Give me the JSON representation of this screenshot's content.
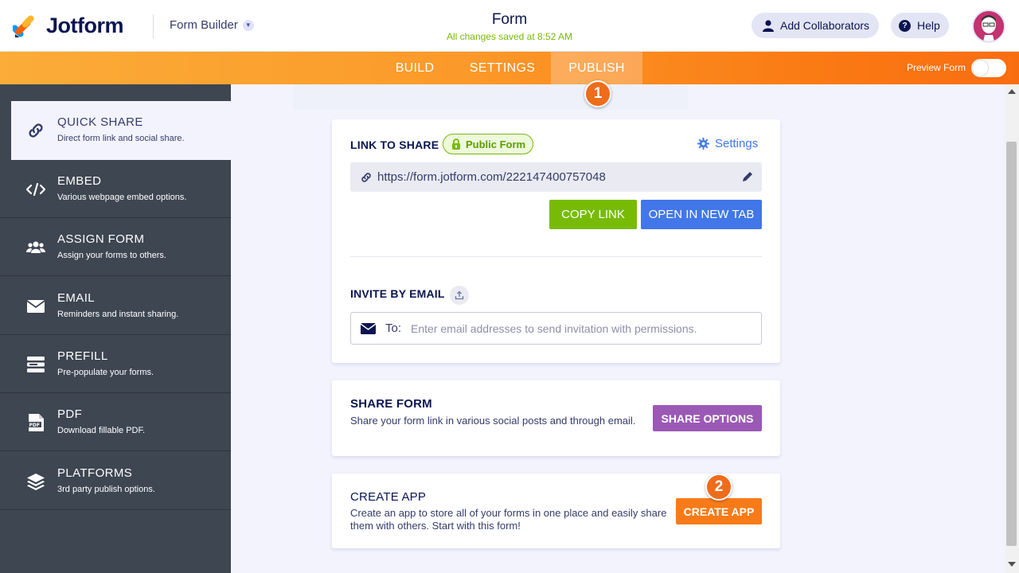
{
  "header": {
    "logo_text": "Jotform",
    "builder_label": "Form Builder",
    "form_title": "Form",
    "saved_status": "All changes saved at 8:52 AM",
    "collaborators_label": "Add Collaborators",
    "help_label": "Help"
  },
  "navbar": {
    "tabs": [
      {
        "label": "BUILD"
      },
      {
        "label": "SETTINGS"
      },
      {
        "label": "PUBLISH"
      }
    ],
    "active_tab": "PUBLISH",
    "preview_label": "Preview Form",
    "preview_enabled": false
  },
  "steps": {
    "step1": "1",
    "step2": "2"
  },
  "sidebar": {
    "items": [
      {
        "title": "QUICK SHARE",
        "desc": "Direct form link and social share.",
        "icon": "link-icon",
        "active": true
      },
      {
        "title": "EMBED",
        "desc": "Various webpage embed options.",
        "icon": "code-icon"
      },
      {
        "title": "ASSIGN FORM",
        "desc": "Assign your forms to others.",
        "icon": "users-icon"
      },
      {
        "title": "EMAIL",
        "desc": "Reminders and instant sharing.",
        "icon": "envelope-icon"
      },
      {
        "title": "PREFILL",
        "desc": "Pre-populate your forms.",
        "icon": "prefill-icon"
      },
      {
        "title": "PDF",
        "desc": "Download fillable PDF.",
        "icon": "pdf-icon"
      },
      {
        "title": "PLATFORMS",
        "desc": "3rd party publish options.",
        "icon": "layers-icon"
      }
    ]
  },
  "link_card": {
    "title": "LINK TO SHARE",
    "badge": "Public Form",
    "settings_label": "Settings",
    "url": "https://form.jotform.com/222147400757048",
    "copy_label": "COPY LINK",
    "open_label": "OPEN IN NEW TAB",
    "invite_title": "INVITE BY EMAIL",
    "to_label": "To:",
    "email_placeholder": "Enter email addresses to send invitation with permissions."
  },
  "share_card": {
    "title": "SHARE FORM",
    "desc": "Share your form link in various social posts and through email.",
    "button": "SHARE OPTIONS"
  },
  "app_card": {
    "title": "CREATE APP",
    "desc": "Create an app to store all of your forms in one place and easily share them with others. Start with this form!",
    "button": "CREATE APP"
  },
  "colors": {
    "orange": "#f97b18",
    "green": "#78bb07",
    "blue": "#4277ea",
    "purple": "#9b59b6",
    "sidebar": "#3e4652"
  }
}
